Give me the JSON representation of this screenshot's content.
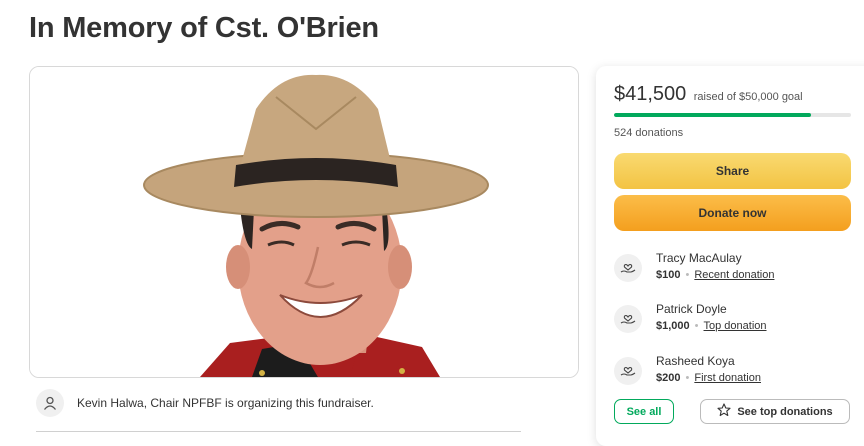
{
  "page": {
    "title": "In Memory of Cst. O'Brien"
  },
  "organizer": {
    "text": "Kevin Halwa, Chair NPFBF is organizing this fundraiser."
  },
  "donation_card": {
    "raised_amount": "$41,500",
    "raised_goal_text": "raised of $50,000 goal",
    "progress_fraction": 0.83,
    "donation_count": "524 donations",
    "share_label": "Share",
    "donate_label": "Donate now",
    "donors": [
      {
        "name": "Tracy MacAulay",
        "amount": "$100",
        "tag": "Recent donation"
      },
      {
        "name": "Patrick Doyle",
        "amount": "$1,000",
        "tag": "Top donation"
      },
      {
        "name": "Rasheed Koya",
        "amount": "$200",
        "tag": "First donation"
      }
    ],
    "see_all_label": "See all",
    "see_top_label": "See top donations"
  },
  "colors": {
    "accent_green": "#02a95c",
    "share_yellow": "#f3c343",
    "donate_orange": "#f49f1e"
  },
  "icons": {
    "organizer": "user-icon",
    "donor": "hand-heart-icon",
    "see_top": "star-icon"
  }
}
